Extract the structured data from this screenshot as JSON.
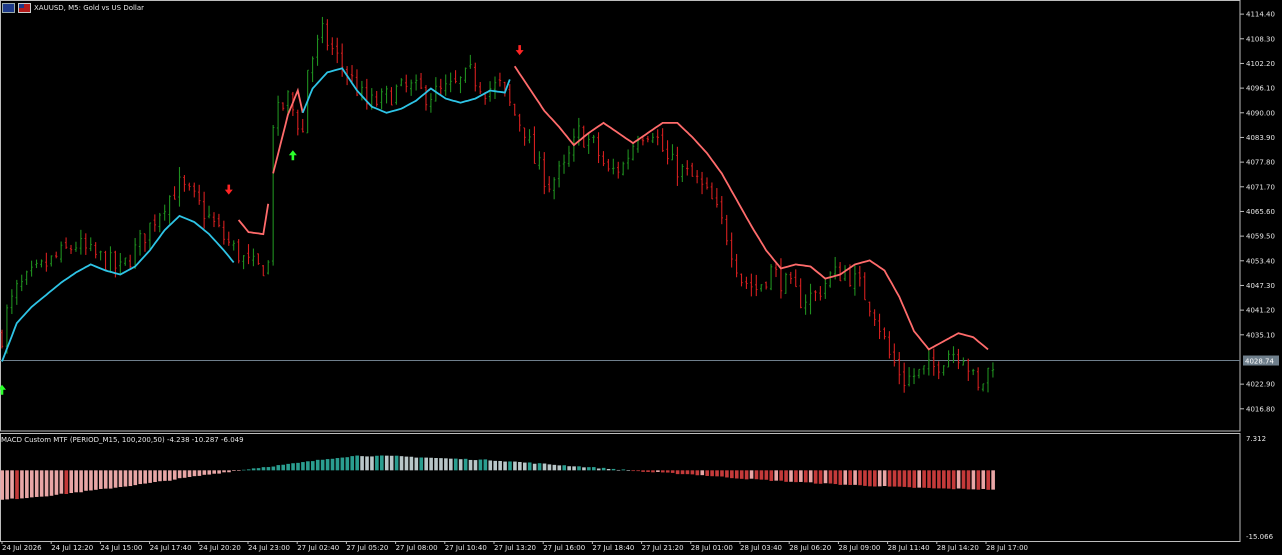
{
  "header": {
    "symbol_title": "XAUUSD, M5:  Gold vs US Dollar",
    "icons": [
      "eu-flag-icon",
      "us-flag-icon"
    ]
  },
  "chart_data": [
    {
      "type": "candlestick",
      "symbol": "XAUUSD",
      "timeframe": "M5",
      "title": "XAUUSD, M5:  Gold vs US Dollar",
      "xlabel": "",
      "ylabel": "",
      "x_ticks": [
        "24 Jul 2026",
        "24 Jul 12:20",
        "24 Jul 15:00",
        "24 Jul 17:40",
        "24 Jul 20:20",
        "24 Jul 23:00",
        "27 Jul 02:40",
        "27 Jul 05:20",
        "27 Jul 08:00",
        "27 Jul 10:40",
        "27 Jul 13:20",
        "27 Jul 16:00",
        "27 Jul 18:40",
        "27 Jul 21:20",
        "28 Jul 01:00",
        "28 Jul 03:40",
        "28 Jul 06:20",
        "28 Jul 09:00",
        "28 Jul 11:40",
        "28 Jul 14:20",
        "28 Jul 17:00"
      ],
      "y_ticks": [
        "4114.40",
        "4108.30",
        "4102.20",
        "4096.10",
        "4090.00",
        "4083.90",
        "4077.80",
        "4071.70",
        "4065.60",
        "4059.50",
        "4053.40",
        "4047.30",
        "4041.20",
        "4035.10",
        "4022.90",
        "4016.80"
      ],
      "ylim": [
        4012.3,
        4116.9
      ],
      "current_price": "4028.74",
      "grid": false,
      "colors": {
        "bull": "#1f8f1f",
        "bear": "#d41f1f",
        "trend_up": "#2ec4e6",
        "trend_down": "#ff6b6b",
        "price_line": "#6f7f8c"
      },
      "series": [
        {
          "style": "candles",
          "close_path": [
            [
              0,
              4035.0
            ],
            [
              1,
              4040.5
            ],
            [
              3,
              4046.0
            ],
            [
              6,
              4049.5
            ],
            [
              9,
              4052.5
            ],
            [
              12,
              4055.0
            ],
            [
              15,
              4057.5
            ],
            [
              18,
              4055.0
            ],
            [
              21,
              4053.5
            ],
            [
              24,
              4051.0
            ],
            [
              27,
              4056.0
            ],
            [
              30,
              4062.0
            ],
            [
              33,
              4068.0
            ],
            [
              36,
              4072.0
            ],
            [
              39,
              4068.5
            ],
            [
              42,
              4064.0
            ],
            [
              45,
              4059.0
            ],
            [
              48,
              4055.0
            ],
            [
              50,
              4052.5
            ],
            [
              52,
              4051.5
            ],
            [
              54,
              4052.5
            ],
            [
              55,
              4088.0
            ],
            [
              58,
              4093.5
            ],
            [
              61,
              4085.0
            ],
            [
              62,
              4101.0
            ],
            [
              65,
              4109.5
            ],
            [
              68,
              4103.5
            ],
            [
              71,
              4098.0
            ],
            [
              74,
              4092.0
            ],
            [
              77,
              4093.0
            ],
            [
              80,
              4095.5
            ],
            [
              83,
              4096.0
            ],
            [
              86,
              4094.5
            ],
            [
              89,
              4095.0
            ],
            [
              92,
              4096.5
            ],
            [
              95,
              4099.5
            ],
            [
              98,
              4096.0
            ],
            [
              101,
              4096.5
            ],
            [
              104,
              4089.5
            ],
            [
              106,
              4086.0
            ],
            [
              108,
              4078.0
            ],
            [
              111,
              4072.5
            ],
            [
              114,
              4076.0
            ],
            [
              117,
              4085.0
            ],
            [
              120,
              4082.0
            ],
            [
              123,
              4075.0
            ],
            [
              126,
              4077.0
            ],
            [
              129,
              4085.0
            ],
            [
              132,
              4086.0
            ],
            [
              135,
              4078.0
            ],
            [
              138,
              4075.5
            ],
            [
              141,
              4073.0
            ],
            [
              144,
              4068.0
            ],
            [
              147,
              4060.0
            ],
            [
              150,
              4049.0
            ],
            [
              153,
              4046.5
            ],
            [
              156,
              4051.0
            ],
            [
              159,
              4047.5
            ],
            [
              162,
              4044.0
            ],
            [
              165,
              4045.0
            ],
            [
              168,
              4049.5
            ],
            [
              171,
              4051.0
            ],
            [
              174,
              4047.0
            ],
            [
              177,
              4041.0
            ],
            [
              180,
              4030.0
            ],
            [
              183,
              4024.0
            ],
            [
              186,
              4025.5
            ],
            [
              189,
              4027.0
            ],
            [
              192,
              4031.0
            ],
            [
              195,
              4030.5
            ],
            [
              198,
              4021.0
            ],
            [
              201,
              4028.74
            ]
          ]
        },
        {
          "style": "trend_line",
          "path": [
            [
              0,
              4028.5
            ],
            [
              3,
              4038.0
            ],
            [
              6,
              4042.0
            ],
            [
              9,
              4045.0
            ],
            [
              12,
              4048.0
            ],
            [
              15,
              4050.5
            ],
            [
              18,
              4052.5
            ],
            [
              21,
              4051.0
            ],
            [
              24,
              4050.0
            ],
            [
              27,
              4052.0
            ],
            [
              30,
              4056.0
            ],
            [
              33,
              4061.0
            ],
            [
              36,
              4064.5
            ],
            [
              39,
              4063.0
            ],
            [
              42,
              4060.0
            ],
            [
              45,
              4056.0
            ],
            [
              47,
              4053.0
            ],
            [
              48,
              4063.5
            ],
            [
              50,
              4060.5
            ],
            [
              53,
              4060.0
            ],
            [
              55,
              4075.0
            ],
            [
              58,
              4089.5
            ],
            [
              60,
              4095.5
            ],
            [
              61,
              4090.0
            ],
            [
              63,
              4096.0
            ],
            [
              66,
              4100.0
            ],
            [
              69,
              4101.0
            ],
            [
              72,
              4095.5
            ],
            [
              75,
              4091.5
            ],
            [
              78,
              4090.0
            ],
            [
              81,
              4091.0
            ],
            [
              84,
              4093.0
            ],
            [
              87,
              4096.0
            ],
            [
              90,
              4093.5
            ],
            [
              93,
              4092.5
            ],
            [
              96,
              4093.5
            ],
            [
              99,
              4095.5
            ],
            [
              102,
              4095.0
            ],
            [
              104,
              4101.5
            ],
            [
              107,
              4096.0
            ],
            [
              110,
              4090.5
            ],
            [
              113,
              4086.5
            ],
            [
              116,
              4082.0
            ],
            [
              119,
              4085.0
            ],
            [
              122,
              4087.5
            ],
            [
              125,
              4085.0
            ],
            [
              128,
              4082.5
            ],
            [
              131,
              4085.0
            ],
            [
              134,
              4087.5
            ],
            [
              137,
              4087.5
            ],
            [
              140,
              4084.0
            ],
            [
              143,
              4080.0
            ],
            [
              146,
              4075.0
            ],
            [
              149,
              4068.5
            ],
            [
              152,
              4062.0
            ],
            [
              155,
              4056.0
            ],
            [
              158,
              4051.5
            ],
            [
              161,
              4052.5
            ],
            [
              164,
              4052.0
            ],
            [
              167,
              4049.0
            ],
            [
              170,
              4050.0
            ],
            [
              173,
              4052.5
            ],
            [
              176,
              4053.5
            ],
            [
              179,
              4051.0
            ],
            [
              182,
              4044.5
            ],
            [
              185,
              4036.0
            ],
            [
              188,
              4031.5
            ],
            [
              191,
              4033.5
            ],
            [
              194,
              4035.5
            ],
            [
              197,
              4034.5
            ],
            [
              200,
              4031.5
            ]
          ]
        }
      ],
      "signals": [
        {
          "type": "buy",
          "x": 0,
          "price": 4021.5
        },
        {
          "type": "sell",
          "x": 46,
          "price": 4071.0
        },
        {
          "type": "buy",
          "x": 59,
          "price": 4079.5
        },
        {
          "type": "sell",
          "x": 105,
          "price": 4105.5
        }
      ]
    },
    {
      "type": "histogram",
      "title": "MACD Custom MTF (PERIOD_M15, 100,200,50) -4.238 -10.287 -6.049",
      "xlabel": "",
      "ylabel": "",
      "ylim": [
        -15.066,
        7.312
      ],
      "y_ticks": [
        "7.312",
        "-15.066"
      ],
      "colors": {
        "rising_pos": "#2a9d8f",
        "falling_pos": "#b9c6c8",
        "falling_neg": "#c43a3a",
        "rising_neg": "#e8a6a6"
      },
      "series": [
        {
          "name": "",
          "profile": [
            [
              0,
              -6.5
            ],
            [
              10,
              -5.5
            ],
            [
              20,
              -4.2
            ],
            [
              30,
              -2.8
            ],
            [
              40,
              -1.2
            ],
            [
              50,
              0.3
            ],
            [
              60,
              1.6
            ],
            [
              68,
              2.8
            ],
            [
              72,
              3.2
            ],
            [
              80,
              3.1
            ],
            [
              90,
              2.6
            ],
            [
              100,
              2.2
            ],
            [
              110,
              1.4
            ],
            [
              120,
              0.6
            ],
            [
              125,
              0.2
            ],
            [
              130,
              -0.3
            ],
            [
              140,
              -0.9
            ],
            [
              150,
              -1.8
            ],
            [
              160,
              -2.5
            ],
            [
              170,
              -3.1
            ],
            [
              180,
              -3.6
            ],
            [
              190,
              -4.0
            ],
            [
              200,
              -4.2
            ]
          ],
          "last_value": -4.238
        }
      ]
    }
  ]
}
